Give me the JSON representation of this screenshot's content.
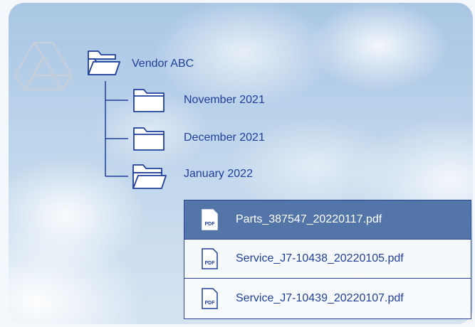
{
  "tree": {
    "root": {
      "label": "Vendor ABC",
      "icon": "folder-open-icon"
    },
    "children": [
      {
        "label": "November 2021",
        "icon": "folder-icon"
      },
      {
        "label": "December 2021",
        "icon": "folder-icon"
      },
      {
        "label": "January 2022",
        "icon": "folder-open-icon"
      }
    ]
  },
  "files": [
    {
      "name": "Parts_387547_20220117.pdf",
      "icon_text": "PDF",
      "selected": true
    },
    {
      "name": "Service_J7-10438_20220105.pdf",
      "icon_text": "PDF",
      "selected": false
    },
    {
      "name": "Service_J7-10439_20220107.pdf",
      "icon_text": "PDF",
      "selected": false
    }
  ],
  "colors": {
    "accent": "#1f3f9c",
    "selected_row": "#5475a8",
    "border": "#2a4597"
  }
}
